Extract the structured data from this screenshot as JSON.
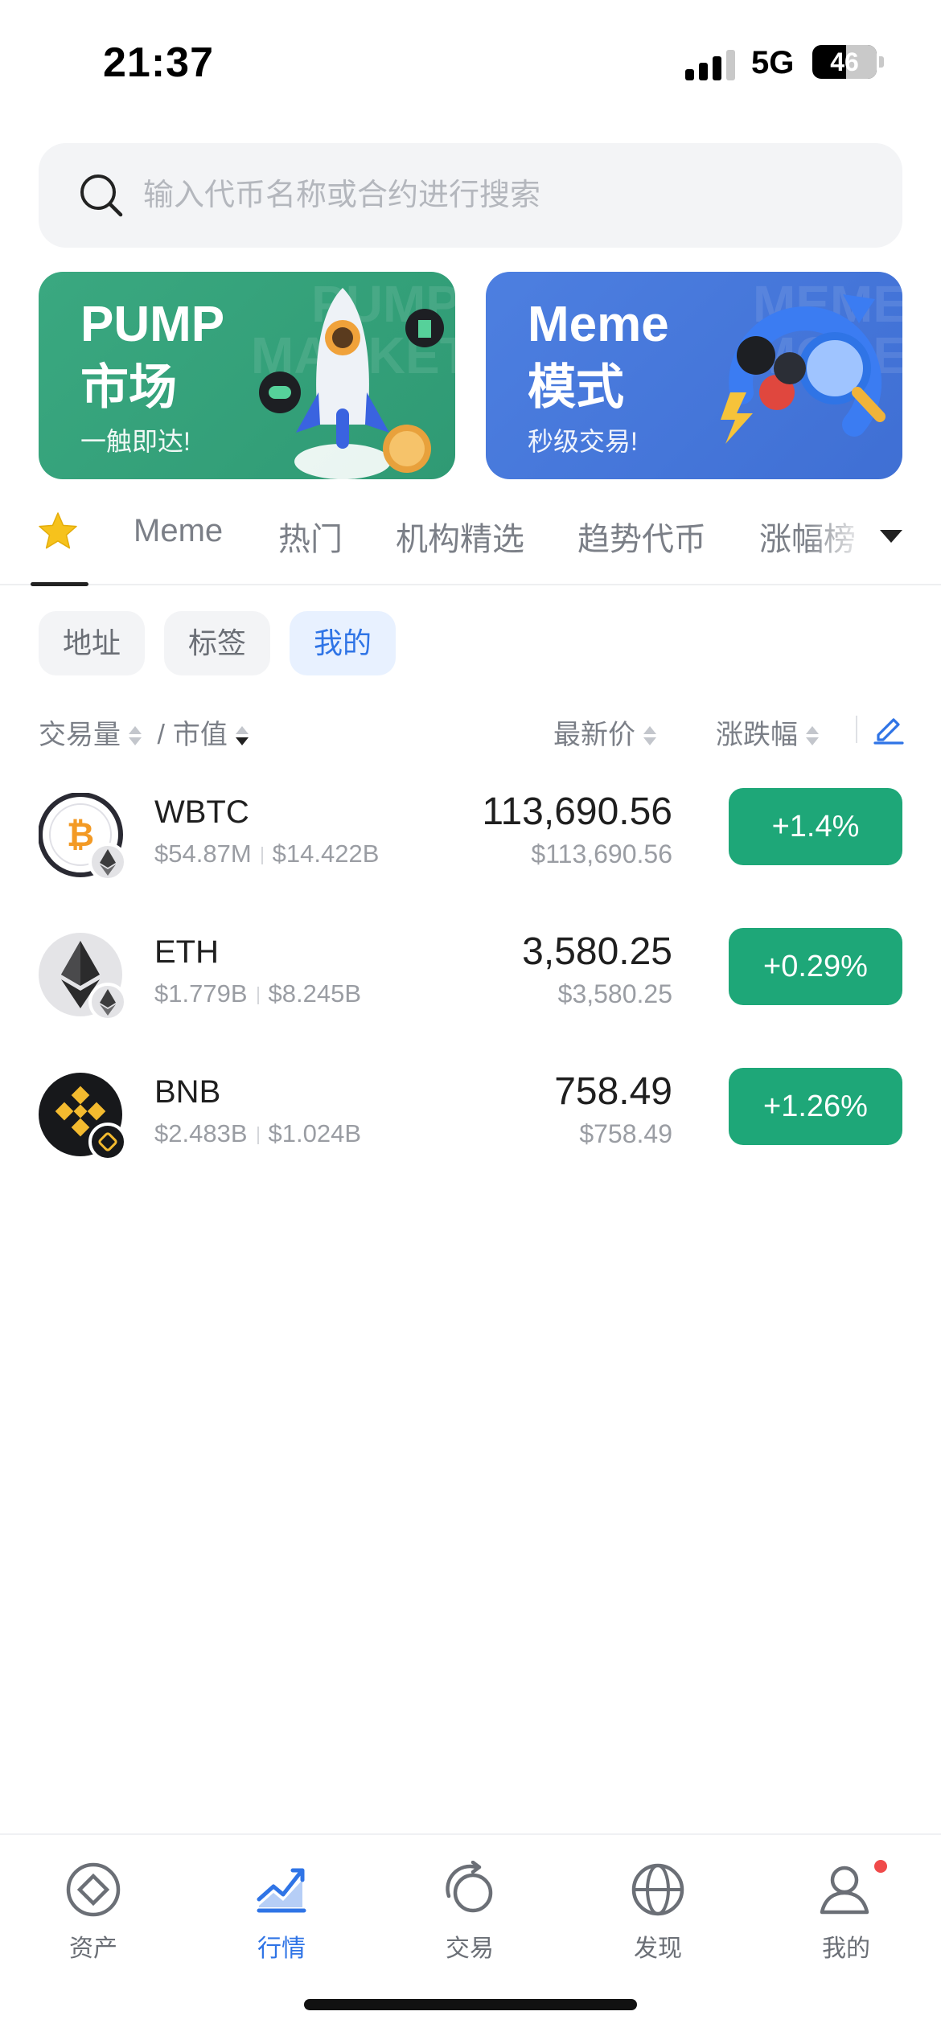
{
  "status_bar": {
    "time": "21:37",
    "network": "5G",
    "battery": "46"
  },
  "search": {
    "placeholder": "输入代币名称或合约进行搜索"
  },
  "banners": [
    {
      "title": "PUMP",
      "title2": "市场",
      "subtitle": "一触即达!",
      "watermark": "PUMP MARKET",
      "color": "#3aa880"
    },
    {
      "title": "Meme",
      "title2": "模式",
      "subtitle": "秒级交易!",
      "watermark": "MEME MODE",
      "color": "#4d7fe0"
    }
  ],
  "tabs": [
    "Meme",
    "热门",
    "机构精选",
    "趋势代币",
    "涨幅榜"
  ],
  "filters": [
    "地址",
    "标签",
    "我的"
  ],
  "columns": {
    "volume": "交易量",
    "slash": "/",
    "mcap": "市值",
    "price": "最新价",
    "change": "涨跌幅"
  },
  "coins": [
    {
      "symbol": "WBTC",
      "volume": "$54.87M",
      "mcap": "$14.422B",
      "price": "113,690.56",
      "price_usd": "$113,690.56",
      "change": "+1.4%",
      "icon": "bitcoin-icon"
    },
    {
      "symbol": "ETH",
      "volume": "$1.779B",
      "mcap": "$8.245B",
      "price": "3,580.25",
      "price_usd": "$3,580.25",
      "change": "+0.29%",
      "icon": "ethereum-icon"
    },
    {
      "symbol": "BNB",
      "volume": "$2.483B",
      "mcap": "$1.024B",
      "price": "758.49",
      "price_usd": "$758.49",
      "change": "+1.26%",
      "icon": "bnb-icon"
    }
  ],
  "nav": [
    "资产",
    "行情",
    "交易",
    "发现",
    "我的"
  ],
  "colors": {
    "accent": "#2f74e6",
    "up": "#1ea778",
    "pump_banner": "#3aa880",
    "meme_banner": "#4d7fe0"
  }
}
